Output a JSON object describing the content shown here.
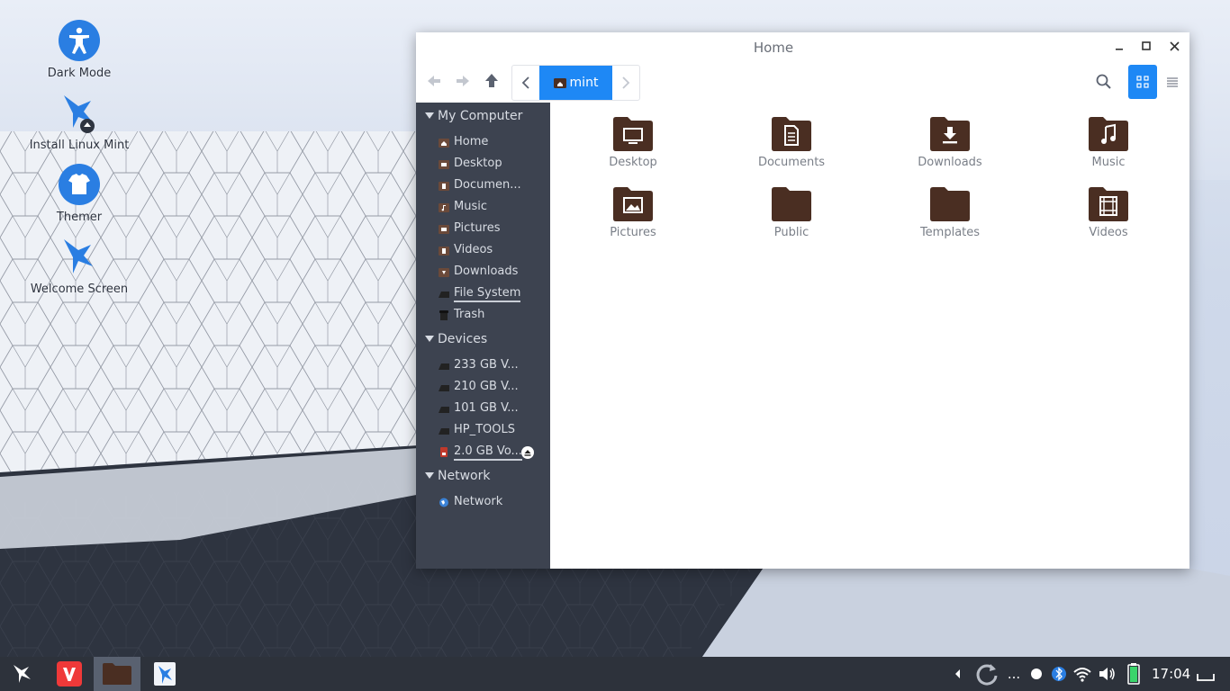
{
  "desktop": {
    "icons": [
      {
        "label": "Dark Mode"
      },
      {
        "label": "Install Linux Mint"
      },
      {
        "label": "Themer"
      },
      {
        "label": "Welcome Screen"
      }
    ]
  },
  "window": {
    "title": "Home",
    "path": {
      "crumb": "mint"
    },
    "sidebar": {
      "sections": [
        {
          "title": "My Computer"
        },
        {
          "title": "Devices"
        },
        {
          "title": "Network"
        }
      ],
      "my_computer": [
        {
          "label": "Home",
          "icon": "home-icon"
        },
        {
          "label": "Desktop",
          "icon": "desktop-icon"
        },
        {
          "label": "Documen...",
          "icon": "document-icon"
        },
        {
          "label": "Music",
          "icon": "music-icon"
        },
        {
          "label": "Pictures",
          "icon": "picture-icon"
        },
        {
          "label": "Videos",
          "icon": "video-icon"
        },
        {
          "label": "Downloads",
          "icon": "download-icon"
        },
        {
          "label": "File System",
          "icon": "drive-icon"
        },
        {
          "label": "Trash",
          "icon": "trash-icon"
        }
      ],
      "devices": [
        {
          "label": "233 GB V..."
        },
        {
          "label": "210 GB V..."
        },
        {
          "label": "101 GB V..."
        },
        {
          "label": "HP_TOOLS"
        },
        {
          "label": "2.0 GB Vo..."
        }
      ],
      "network": [
        {
          "label": "Network"
        }
      ]
    },
    "folders": [
      {
        "name": "Desktop",
        "icon": "desktop-icon"
      },
      {
        "name": "Documents",
        "icon": "document-icon"
      },
      {
        "name": "Downloads",
        "icon": "download-icon"
      },
      {
        "name": "Music",
        "icon": "music-icon"
      },
      {
        "name": "Pictures",
        "icon": "picture-icon"
      },
      {
        "name": "Public",
        "icon": "none"
      },
      {
        "name": "Templates",
        "icon": "none"
      },
      {
        "name": "Videos",
        "icon": "video-icon"
      }
    ]
  },
  "taskbar": {
    "clock": "17:04",
    "overflow": "..."
  },
  "colors": {
    "accent": "#1e88f5",
    "sidebar_bg": "#3d4350",
    "folder_brown": "#4a2e22",
    "taskbar_bg": "#2d323b",
    "desktop_icon_blue": "#2a7ee2"
  }
}
